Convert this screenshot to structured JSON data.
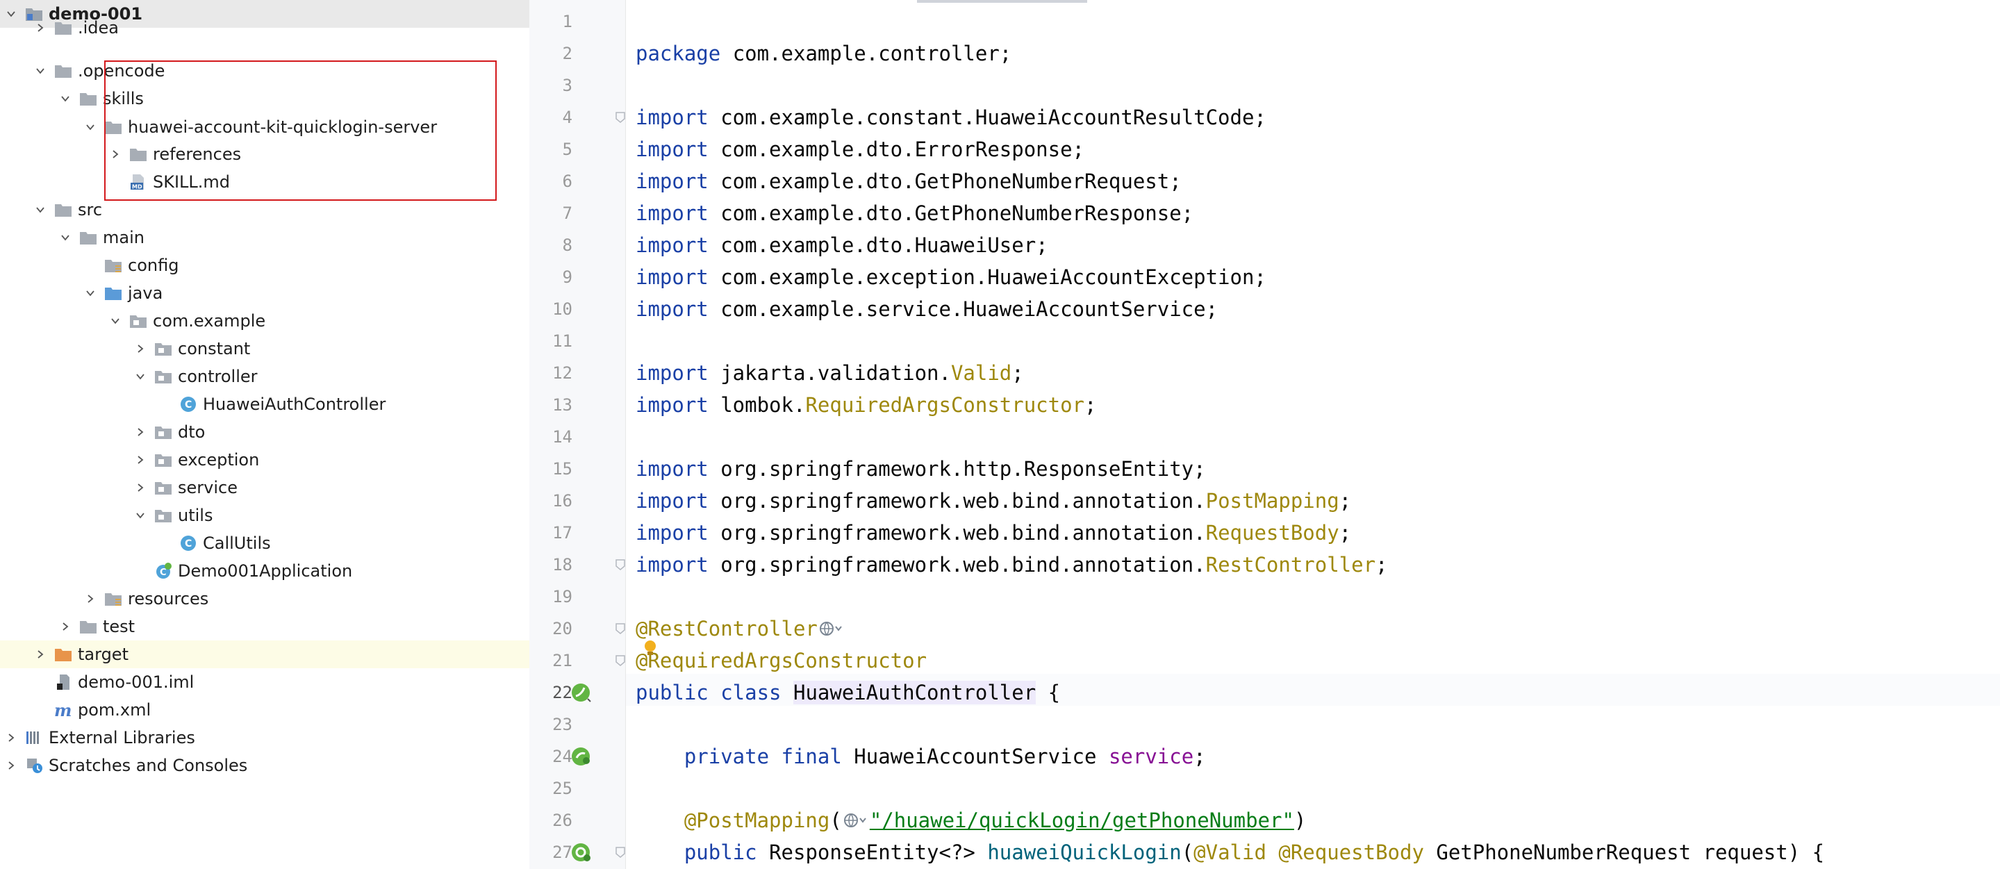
{
  "project_tree": {
    "items": [
      {
        "label": "demo-001",
        "icon": "module-folder-icon",
        "chevron": "down",
        "bold": true
      },
      {
        "label": ".idea",
        "icon": "folder-icon",
        "chevron": "right"
      },
      {
        "label": ".opencode",
        "icon": "folder-icon",
        "chevron": "down"
      },
      {
        "label": "skills",
        "icon": "folder-icon",
        "chevron": "down"
      },
      {
        "label": "huawei-account-kit-quicklogin-server",
        "icon": "folder-icon",
        "chevron": "down"
      },
      {
        "label": "references",
        "icon": "folder-icon",
        "chevron": "right"
      },
      {
        "label": "SKILL.md",
        "icon": "markdown-file-icon",
        "chevron": "none"
      },
      {
        "label": "src",
        "icon": "folder-icon",
        "chevron": "down"
      },
      {
        "label": "main",
        "icon": "folder-icon",
        "chevron": "down"
      },
      {
        "label": "config",
        "icon": "resource-folder-icon",
        "chevron": "none"
      },
      {
        "label": "java",
        "icon": "source-folder-icon",
        "chevron": "down"
      },
      {
        "label": "com.example",
        "icon": "package-icon",
        "chevron": "down"
      },
      {
        "label": "constant",
        "icon": "package-icon",
        "chevron": "right"
      },
      {
        "label": "controller",
        "icon": "package-icon",
        "chevron": "down"
      },
      {
        "label": "HuaweiAuthController",
        "icon": "class-icon",
        "chevron": "none"
      },
      {
        "label": "dto",
        "icon": "package-icon",
        "chevron": "right"
      },
      {
        "label": "exception",
        "icon": "package-icon",
        "chevron": "right"
      },
      {
        "label": "service",
        "icon": "package-icon",
        "chevron": "right"
      },
      {
        "label": "utils",
        "icon": "package-icon",
        "chevron": "down"
      },
      {
        "label": "CallUtils",
        "icon": "class-icon",
        "chevron": "none"
      },
      {
        "label": "Demo001Application",
        "icon": "spring-boot-class-icon",
        "chevron": "none"
      },
      {
        "label": "resources",
        "icon": "resource-folder-icon",
        "chevron": "right"
      },
      {
        "label": "test",
        "icon": "folder-icon",
        "chevron": "right"
      },
      {
        "label": "target",
        "icon": "excluded-folder-icon",
        "chevron": "right"
      },
      {
        "label": "demo-001.iml",
        "icon": "iml-file-icon",
        "chevron": "none"
      },
      {
        "label": "pom.xml",
        "icon": "maven-icon",
        "chevron": "none"
      },
      {
        "label": "External Libraries",
        "icon": "libraries-icon",
        "chevron": "right"
      },
      {
        "label": "Scratches and Consoles",
        "icon": "scratches-icon",
        "chevron": "right"
      }
    ]
  },
  "editor": {
    "file": "HuaweiAuthController.java",
    "lines": [
      {
        "n": "1",
        "tokens": []
      },
      {
        "n": "2",
        "tokens": [
          {
            "t": "package ",
            "c": "kw"
          },
          {
            "t": "com.example.controller;",
            "c": ""
          }
        ]
      },
      {
        "n": "3",
        "tokens": []
      },
      {
        "n": "4",
        "tokens": [
          {
            "t": "import ",
            "c": "kw"
          },
          {
            "t": "com.example.constant.HuaweiAccountResultCode;",
            "c": ""
          }
        ]
      },
      {
        "n": "5",
        "tokens": [
          {
            "t": "import ",
            "c": "kw"
          },
          {
            "t": "com.example.dto.ErrorResponse;",
            "c": ""
          }
        ]
      },
      {
        "n": "6",
        "tokens": [
          {
            "t": "import ",
            "c": "kw"
          },
          {
            "t": "com.example.dto.GetPhoneNumberRequest;",
            "c": ""
          }
        ]
      },
      {
        "n": "7",
        "tokens": [
          {
            "t": "import ",
            "c": "kw"
          },
          {
            "t": "com.example.dto.GetPhoneNumberResponse;",
            "c": ""
          }
        ]
      },
      {
        "n": "8",
        "tokens": [
          {
            "t": "import ",
            "c": "kw"
          },
          {
            "t": "com.example.dto.HuaweiUser;",
            "c": ""
          }
        ]
      },
      {
        "n": "9",
        "tokens": [
          {
            "t": "import ",
            "c": "kw"
          },
          {
            "t": "com.example.exception.HuaweiAccountException;",
            "c": ""
          }
        ]
      },
      {
        "n": "10",
        "tokens": [
          {
            "t": "import ",
            "c": "kw"
          },
          {
            "t": "com.example.service.HuaweiAccountService;",
            "c": ""
          }
        ]
      },
      {
        "n": "11",
        "tokens": []
      },
      {
        "n": "12",
        "tokens": [
          {
            "t": "import ",
            "c": "kw"
          },
          {
            "t": "jakarta.validation.",
            "c": ""
          },
          {
            "t": "Valid",
            "c": "ann"
          },
          {
            "t": ";",
            "c": ""
          }
        ]
      },
      {
        "n": "13",
        "tokens": [
          {
            "t": "import ",
            "c": "kw"
          },
          {
            "t": "lombok.",
            "c": ""
          },
          {
            "t": "RequiredArgsConstructor",
            "c": "ann"
          },
          {
            "t": ";",
            "c": ""
          }
        ]
      },
      {
        "n": "14",
        "tokens": []
      },
      {
        "n": "15",
        "tokens": [
          {
            "t": "import ",
            "c": "kw"
          },
          {
            "t": "org.springframework.http.ResponseEntity;",
            "c": ""
          }
        ]
      },
      {
        "n": "16",
        "tokens": [
          {
            "t": "import ",
            "c": "kw"
          },
          {
            "t": "org.springframework.web.bind.annotation.",
            "c": ""
          },
          {
            "t": "PostMapping",
            "c": "ann"
          },
          {
            "t": ";",
            "c": ""
          }
        ]
      },
      {
        "n": "17",
        "tokens": [
          {
            "t": "import ",
            "c": "kw"
          },
          {
            "t": "org.springframework.web.bind.annotation.",
            "c": ""
          },
          {
            "t": "RequestBody",
            "c": "ann"
          },
          {
            "t": ";",
            "c": ""
          }
        ]
      },
      {
        "n": "18",
        "tokens": [
          {
            "t": "import ",
            "c": "kw"
          },
          {
            "t": "org.springframework.web.bind.annotation.",
            "c": ""
          },
          {
            "t": "RestController",
            "c": "ann"
          },
          {
            "t": ";",
            "c": ""
          }
        ]
      },
      {
        "n": "19",
        "tokens": []
      },
      {
        "n": "20",
        "tokens": [
          {
            "t": "@RestController",
            "c": "ann"
          },
          {
            "inlay": true
          }
        ]
      },
      {
        "n": "21",
        "tokens": [
          {
            "t": "@RequiredArgsConstructor",
            "c": "ann"
          }
        ]
      },
      {
        "n": "22",
        "tokens": [
          {
            "t": "public class ",
            "c": "kw"
          },
          {
            "t": "HuaweiAuthController",
            "c": "hlname"
          },
          {
            "t": " {",
            "c": ""
          }
        ]
      },
      {
        "n": "23",
        "tokens": []
      },
      {
        "n": "24",
        "tokens": [
          {
            "t": "    private final ",
            "c": "kw"
          },
          {
            "t": "HuaweiAccountService ",
            "c": ""
          },
          {
            "t": "service",
            "c": "fld"
          },
          {
            "t": ";",
            "c": ""
          }
        ]
      },
      {
        "n": "25",
        "tokens": []
      },
      {
        "n": "26",
        "tokens": [
          {
            "t": "    @PostMapping",
            "c": "ann"
          },
          {
            "t": "(",
            "c": ""
          },
          {
            "inlay": true
          },
          {
            "t": "\"/huawei/quickLogin/getPhoneNumber\"",
            "c": "str"
          },
          {
            "t": ")",
            "c": ""
          }
        ]
      },
      {
        "n": "27",
        "tokens": [
          {
            "t": "    public ",
            "c": "kw"
          },
          {
            "t": "ResponseEntity<?> ",
            "c": ""
          },
          {
            "t": "huaweiQuickLogin",
            "c": "mth"
          },
          {
            "t": "(",
            "c": ""
          },
          {
            "t": "@Valid @RequestBody ",
            "c": "ann"
          },
          {
            "t": "GetPhoneNumberRequest request) {",
            "c": ""
          }
        ]
      }
    ]
  }
}
